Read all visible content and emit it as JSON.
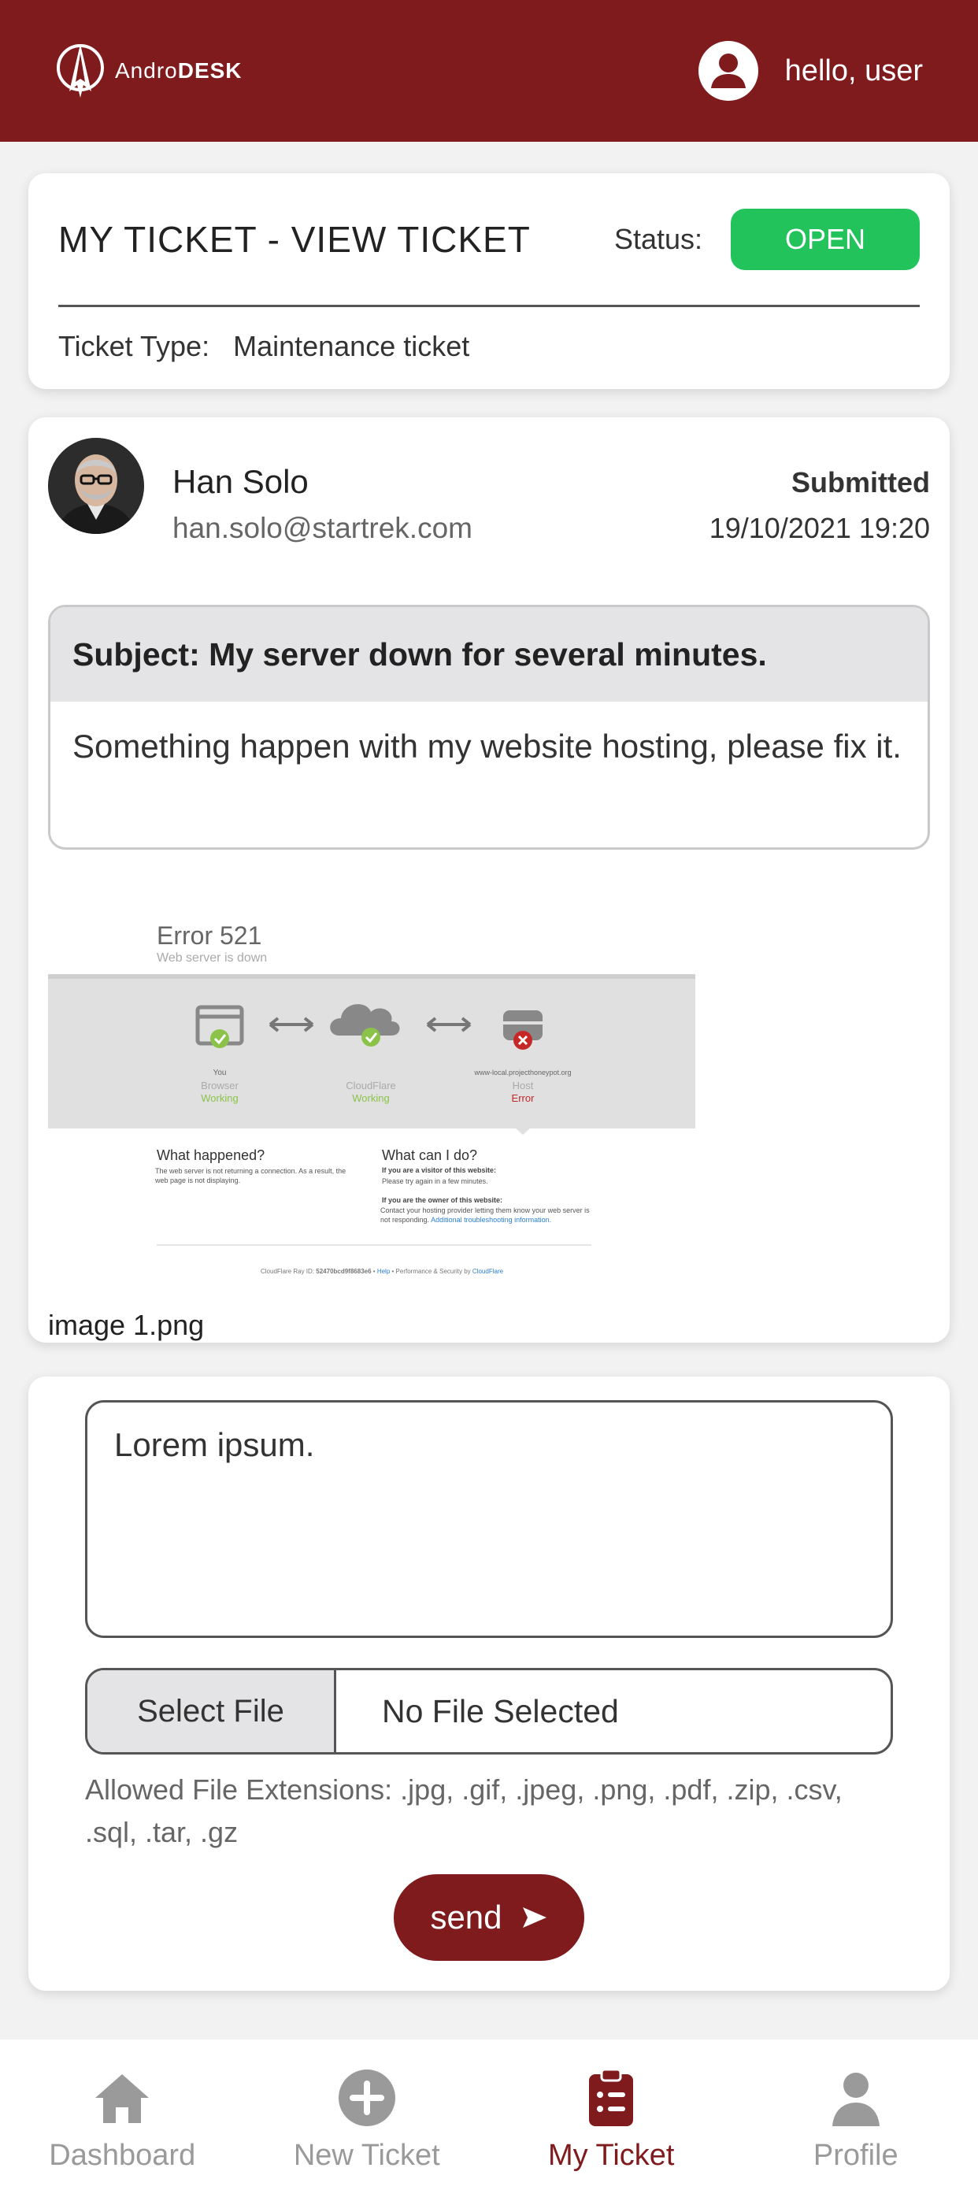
{
  "header": {
    "brand_prefix": "Andro",
    "brand_suffix": "DESK",
    "greeting": "hello, user"
  },
  "ticket": {
    "title": "MY TICKET - VIEW TICKET",
    "status_label": "Status:",
    "status_value": "OPEN",
    "status_color": "#22c35a",
    "type_label": "Ticket Type:",
    "type_value": "Maintenance ticket"
  },
  "message": {
    "author_name": "Han Solo",
    "author_email": "han.solo@startrek.com",
    "submitted_label": "Submitted",
    "submitted_date": "19/10/2021 19:20",
    "subject": "Subject: My server down for several minutes.",
    "body": "Something happen with my website hosting, please fix it.",
    "attachment": {
      "caption": "image 1.png",
      "error_title": "Error 521",
      "error_subtitle": "Web server is down",
      "nodes": [
        {
          "top": "You",
          "name": "Browser",
          "status": "Working",
          "status_color": "#8bc34a"
        },
        {
          "top": "",
          "name": "CloudFlare",
          "status": "Working",
          "status_color": "#8bc34a"
        },
        {
          "top": "www-local.projecthoneypot.org",
          "name": "Host",
          "status": "Error",
          "status_color": "#c62828"
        }
      ],
      "what_happened_title": "What happened?",
      "what_happened_text": "The web server is not returning a connection. As a result, the web page is not displaying.",
      "what_can_title": "What can I do?",
      "visitor_heading": "If you are a visitor of this website:",
      "visitor_text": "Please try again in a few minutes.",
      "owner_heading": "If you are the owner of this website:",
      "owner_text": "Contact your hosting provider letting them know your web server is not responding.",
      "owner_link": "Additional troubleshooting information.",
      "footer_ray_label": "CloudFlare Ray ID:",
      "footer_ray_id": "52470bcd9f8683e6",
      "footer_help": "Help",
      "footer_perf": "Performance & Security by",
      "footer_brand": "CloudFlare"
    }
  },
  "reply": {
    "text": "Lorem ipsum.",
    "select_file_label": "Select File",
    "file_status": "No File Selected",
    "allowed_note": "Allowed File Extensions: .jpg, .gif, .jpeg, .png, .pdf, .zip, .csv, .sql, .tar, .gz",
    "send_label": "send"
  },
  "nav": {
    "items": [
      {
        "label": "Dashboard",
        "icon": "home-icon"
      },
      {
        "label": "New Ticket",
        "icon": "plus-circle-icon"
      },
      {
        "label": "My Ticket",
        "icon": "clipboard-icon",
        "active": true
      },
      {
        "label": "Profile",
        "icon": "person-icon"
      }
    ],
    "active_color": "#7f1a1d",
    "inactive_color": "#9a9a9a"
  }
}
